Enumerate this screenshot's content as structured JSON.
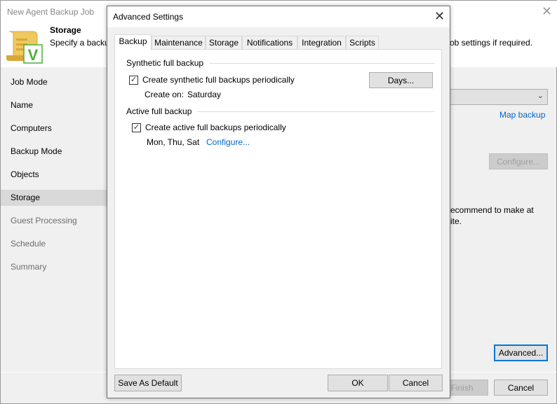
{
  "window": {
    "title": "New Agent Backup Job",
    "close": "✕"
  },
  "header": {
    "title": "Storage",
    "subtitle_left": "Specify a backu",
    "subtitle_right": "ob settings if required."
  },
  "nav": {
    "items": [
      {
        "label": "Job Mode"
      },
      {
        "label": "Name"
      },
      {
        "label": "Computers"
      },
      {
        "label": "Backup Mode"
      },
      {
        "label": "Objects"
      },
      {
        "label": "Storage",
        "selected": true
      },
      {
        "label": "Guest Processing"
      },
      {
        "label": "Schedule"
      },
      {
        "label": "Summary"
      }
    ]
  },
  "main": {
    "map_backup": "Map backup",
    "configure": "Configure...",
    "recommend_line1": "ecommend to make at",
    "recommend_line2": "ite.",
    "advanced": "Advanced...",
    "finish": "Finish",
    "cancel": "Cancel"
  },
  "dialog": {
    "title": "Advanced Settings",
    "close": "✕",
    "tabs": [
      {
        "label": "Backup"
      },
      {
        "label": "Maintenance"
      },
      {
        "label": "Storage"
      },
      {
        "label": "Notifications"
      },
      {
        "label": "Integration"
      },
      {
        "label": "Scripts"
      }
    ],
    "synthetic": {
      "group": "Synthetic full backup",
      "checkbox": "Create synthetic full backups periodically",
      "checked": true,
      "create_on_label": "Create on:",
      "create_on_value": "Saturday",
      "days_button": "Days..."
    },
    "active": {
      "group": "Active full backup",
      "checkbox": "Create active full backups periodically",
      "checked": true,
      "days": "Mon, Thu, Sat",
      "configure": "Configure..."
    },
    "save_default": "Save As Default",
    "ok": "OK",
    "cancel": "Cancel"
  },
  "colors": {
    "accent": "#0078d7",
    "link": "#0066cc",
    "icon_scroll": "#e8b84a",
    "icon_check": "#4caf3c"
  }
}
